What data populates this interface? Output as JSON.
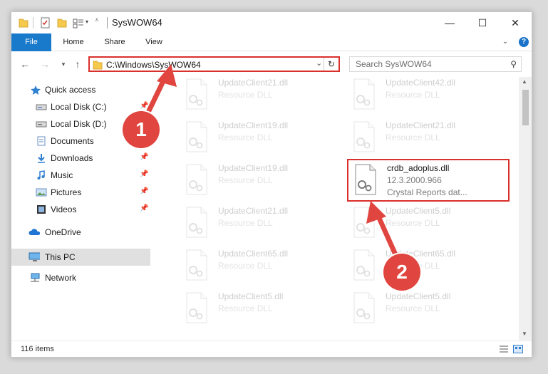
{
  "window": {
    "title": "SysWOW64",
    "controls": {
      "minimize": "—",
      "maximize": "☐",
      "close": "✕"
    }
  },
  "ribbon": {
    "tabs": [
      "File",
      "Home",
      "Share",
      "View"
    ],
    "help": "?"
  },
  "nav": {
    "address": "C:\\Windows\\SysWOW64",
    "search_placeholder": "Search SysWOW64"
  },
  "sidebar": {
    "items": [
      {
        "label": "Quick access",
        "icon": "star-icon",
        "pinned": false
      },
      {
        "label": "Local Disk (C:)",
        "icon": "drive-icon",
        "pinned": true
      },
      {
        "label": "Local Disk (D:)",
        "icon": "drive-icon",
        "pinned": true
      },
      {
        "label": "Documents",
        "icon": "documents-icon",
        "pinned": true
      },
      {
        "label": "Downloads",
        "icon": "downloads-icon",
        "pinned": true
      },
      {
        "label": "Music",
        "icon": "music-icon",
        "pinned": true
      },
      {
        "label": "Pictures",
        "icon": "pictures-icon",
        "pinned": true
      },
      {
        "label": "Videos",
        "icon": "videos-icon",
        "pinned": true
      },
      {
        "label": "OneDrive",
        "icon": "onedrive-icon",
        "pinned": false
      },
      {
        "label": "This PC",
        "icon": "this-pc-icon",
        "pinned": false,
        "selected": true
      },
      {
        "label": "Network",
        "icon": "network-icon",
        "pinned": false
      }
    ]
  },
  "files": [
    {
      "name": "UpdateClient21.dll",
      "desc": "Resource DLL",
      "faded": true
    },
    {
      "name": "UpdateClient42.dll",
      "desc": "Resource DLL",
      "faded": true
    },
    {
      "name": "UpdateClient19.dll",
      "desc": "Resource DLL",
      "faded": true
    },
    {
      "name": "UpdateClient21.dll",
      "desc": "Resource DLL",
      "faded": true
    },
    {
      "name": "UpdateClient19.dll",
      "desc": "Resource DLL",
      "faded": true
    },
    {
      "name": "crdb_adoplus.dll",
      "desc": "12.3.2000.966",
      "desc2": "Crystal Reports dat...",
      "faded": false,
      "highlighted": true
    },
    {
      "name": "UpdateClient21.dll",
      "desc": "Resource DLL",
      "faded": true
    },
    {
      "name": "UpdateClient5.dll",
      "desc": "Resource DLL",
      "faded": true
    },
    {
      "name": "UpdateClient65.dll",
      "desc": "Resource DLL",
      "faded": true
    },
    {
      "name": "UpdateClient65.dll",
      "desc": "Resource DLL",
      "faded": true
    },
    {
      "name": "UpdateClient5.dll",
      "desc": "Resource DLL",
      "faded": true
    },
    {
      "name": "UpdateClient5.dll",
      "desc": "Resource DLL",
      "faded": true
    }
  ],
  "status": {
    "item_count": "116 items"
  },
  "annotations": [
    "1",
    "2"
  ],
  "colors": {
    "accent": "#1979ca",
    "highlight": "#d9302b",
    "annotation": "#e0453f"
  }
}
